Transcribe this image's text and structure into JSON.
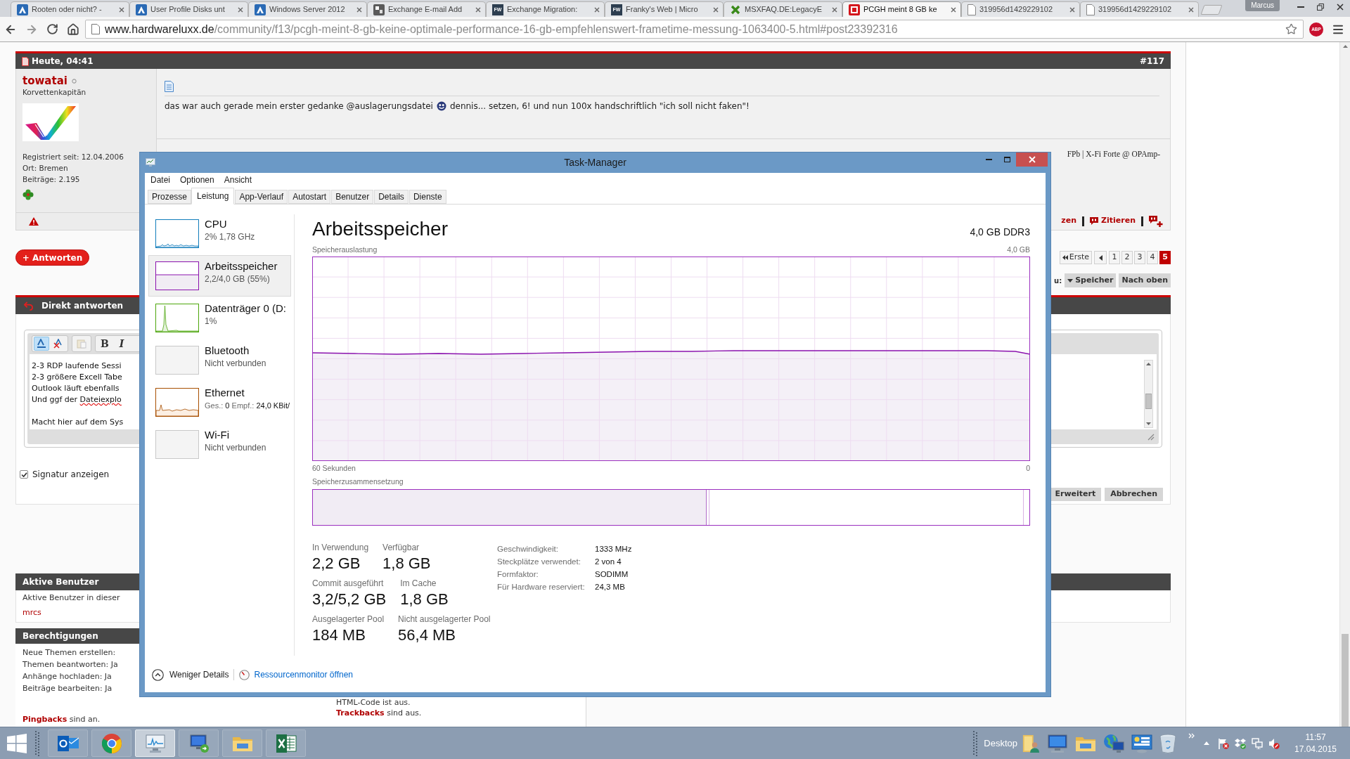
{
  "browser": {
    "tabs": [
      {
        "title": "Rooten oder nicht? -",
        "kind": "tile",
        "selected": false
      },
      {
        "title": "User Profile Disks unt",
        "kind": "tile",
        "selected": false
      },
      {
        "title": "Windows Server 2012",
        "kind": "tile",
        "selected": false
      },
      {
        "title": "Exchange E-mail Add",
        "kind": "tool",
        "selected": false
      },
      {
        "title": "Exchange Migration:",
        "kind": "letters",
        "icon_text": "FW",
        "selected": false
      },
      {
        "title": "Franky's Web | Micro",
        "kind": "letters",
        "icon_text": "FW",
        "selected": false
      },
      {
        "title": "MSXFAQ.DE:LegacyE",
        "kind": "cross",
        "selected": false
      },
      {
        "title": "PCGH meint 8 GB ke",
        "kind": "brand",
        "selected": true
      },
      {
        "title": "319956d1429229102",
        "kind": "page",
        "selected": false
      },
      {
        "title": "319956d1429229102",
        "kind": "page",
        "selected": false
      }
    ],
    "profile": "Marcus",
    "address": {
      "host": "www.hardwareluxx.de",
      "path": "/community/f13/pcgh-meint-8-gb-keine-optimale-performance-16-gb-empfehlenswert-frametime-messung-1063400-5.html#post23392316"
    },
    "extension_badge": "ABP"
  },
  "post": {
    "date": "Heute, 04:41",
    "number": "#117",
    "user": {
      "name": "towatai",
      "rank": "Korvettenkapitän",
      "details": [
        "Registriert seit: 12.04.2006",
        "Ort: Bremen",
        "Beiträge: 2.195"
      ]
    },
    "text_before": "das war auch gerade mein erster gedanke @auslagerungsdatei",
    "text_after": "dennis... setzen, 6! und nun 100x handschriftlich \"ich soll nicht faken\"!",
    "signature": "FPb | X-Fi Forte @ OPAmp-",
    "actions": [
      {
        "kind": "text",
        "label": "zen"
      },
      {
        "kind": "quote",
        "label": "Zitieren"
      },
      {
        "kind": "multi-quote"
      }
    ]
  },
  "reply_button": "+ Antworten",
  "pagination": {
    "first": "Erste",
    "pages": [
      {
        "label": "1",
        "selected": false
      },
      {
        "label": "2",
        "selected": false
      },
      {
        "label": "3",
        "selected": false
      },
      {
        "label": "4",
        "selected": false
      },
      {
        "label": "5",
        "selected": true
      }
    ]
  },
  "navigation": {
    "label": "u:",
    "buttons": [
      {
        "kind": "dropdown",
        "label": "Speicher"
      },
      {
        "kind": "plain",
        "label": "Nach oben"
      }
    ]
  },
  "quick_reply": {
    "title": "Direkt antworten",
    "toolbar": [
      [
        {
          "kind": "format",
          "active": true,
          "disabled": false
        },
        {
          "kind": "clear-format",
          "active": false,
          "disabled": false
        }
      ],
      [
        {
          "kind": "paste",
          "active": false,
          "disabled": true
        }
      ],
      [
        {
          "kind": "bold",
          "label": "B",
          "active": false,
          "disabled": false
        },
        {
          "kind": "italic",
          "label": "I",
          "active": false,
          "disabled": false
        }
      ]
    ],
    "lines": [
      {
        "text": "2-3 RDP laufende Sessi",
        "gap_before": false
      },
      {
        "text": "2-3 größere Excell Tabe",
        "gap_before": false
      },
      {
        "text": "Outlook läuft ebenfalls",
        "gap_before": false
      },
      {
        "text": "Und ggf der ",
        "misspelled": "Dateiexplo",
        "gap_before": false
      },
      {
        "text": "Macht hier auf dem Sys",
        "gap_before": true
      }
    ],
    "signature_option": {
      "label": "Signatur anzeigen",
      "checked": true
    },
    "buttons": [
      "Erweitert",
      "Abbrechen"
    ]
  },
  "active_users": {
    "title": "Aktive Benutzer",
    "text": "Aktive Benutzer in dieser",
    "users": [
      "mrcs"
    ]
  },
  "permissions": {
    "title": "Berechtigungen",
    "lines": [
      "Neue Themen erstellen:",
      "Themen beantworten: Ja",
      "Anhänge hochladen: Ja",
      "Beiträge bearbeiten: Ja"
    ],
    "footer": "**Pingbacks** sind an."
  },
  "posting_rules": [
    "HTML-Code ist aus.",
    "**Trackbacks** sind aus."
  ],
  "task_manager": {
    "title": "Task-Manager",
    "menu": [
      "Datei",
      "Optionen",
      "Ansicht"
    ],
    "tabs": [
      {
        "label": "Prozesse",
        "selected": false
      },
      {
        "label": "Leistung",
        "selected": true
      },
      {
        "label": "App-Verlauf",
        "selected": false
      },
      {
        "label": "Autostart",
        "selected": false
      },
      {
        "label": "Benutzer",
        "selected": false
      },
      {
        "label": "Details",
        "selected": false
      },
      {
        "label": "Dienste",
        "selected": false
      }
    ],
    "resources": [
      {
        "kind": "cpu",
        "name": "CPU",
        "detail": "2% 1,78 GHz",
        "selected": false
      },
      {
        "kind": "memory",
        "name": "Arbeitsspeicher",
        "detail": "2,2/4,0 GB (55%)",
        "selected": true
      },
      {
        "kind": "disk",
        "name": "Datenträger 0 (D:",
        "detail": "1%",
        "selected": false
      },
      {
        "kind": "idle",
        "name": "Bluetooth",
        "detail": "Nicht verbunden",
        "selected": false
      },
      {
        "kind": "network",
        "name": "Ethernet",
        "detail_parts": [
          {
            "label": "Ges.:",
            "value": "0"
          },
          {
            "label": "Empf.:",
            "value": "24,0 KBit/"
          }
        ],
        "selected": false
      },
      {
        "kind": "idle",
        "name": "Wi-Fi",
        "detail": "Nicht verbunden",
        "selected": false
      }
    ],
    "memory": {
      "title": "Arbeitsspeicher",
      "type": "4,0 GB DDR3",
      "usage_label": "Speicherauslastung",
      "usage_max": "4,0 GB",
      "time_start": "60 Sekunden",
      "time_end": "0",
      "composition_label": "Speicherzusammensetzung",
      "composition": {
        "level": 0.55
      },
      "stats": [
        [
          {
            "label": "In Verwendung",
            "value": "2,2 GB"
          },
          {
            "label": "Verfügbar",
            "value": "1,8 GB"
          }
        ],
        [
          {
            "label": "Commit ausgeführt",
            "value": "3,2/5,2 GB"
          },
          {
            "label": "Im Cache",
            "value": "1,8 GB"
          }
        ],
        [
          {
            "label": "Ausgelagerter Pool",
            "value": "184 MB"
          },
          {
            "label": "Nicht ausgelagerter Pool",
            "value": "56,4 MB"
          }
        ]
      ],
      "specs": [
        {
          "label": "Geschwindigkeit:",
          "value": "1333 MHz"
        },
        {
          "label": "Steckplätze verwendet:",
          "value": "2 von 4"
        },
        {
          "label": "Formfaktor:",
          "value": "SODIMM"
        },
        {
          "label": "Für Hardware reserviert:",
          "value": "24,3 MB"
        }
      ]
    },
    "footer": {
      "toggle": "Weniger Details",
      "link": "Ressourcenmonitor öffnen"
    }
  },
  "taskbar": {
    "apps": [
      {
        "kind": "mail",
        "selected": false
      },
      {
        "kind": "browser",
        "selected": false
      },
      {
        "kind": "monitor",
        "selected": true
      },
      {
        "kind": "remote",
        "selected": false
      },
      {
        "kind": "files",
        "selected": false
      },
      {
        "kind": "sheet",
        "selected": false
      }
    ],
    "toolbar_label": "Desktop",
    "toolbar_items": [
      {
        "kind": "user-folder"
      },
      {
        "kind": "computer"
      },
      {
        "kind": "files"
      },
      {
        "kind": "network-computer"
      },
      {
        "kind": "control-panel"
      },
      {
        "kind": "recycle-bin"
      }
    ],
    "tray": [
      {
        "kind": "flag"
      },
      {
        "kind": "sync"
      },
      {
        "kind": "network"
      },
      {
        "kind": "volume-muted"
      }
    ],
    "clock": {
      "time": "11:57",
      "date": "17.04.2015"
    }
  }
}
